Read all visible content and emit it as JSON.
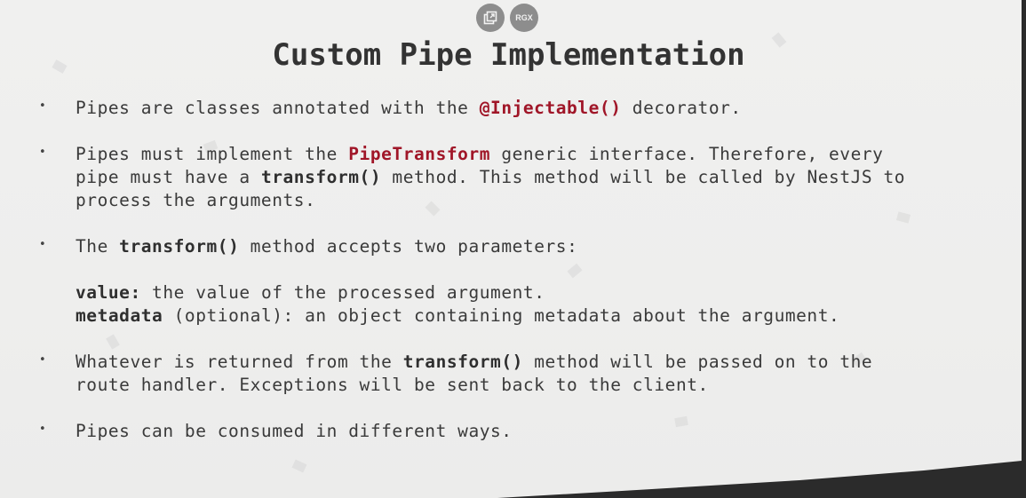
{
  "toolbar": {
    "icons": [
      {
        "name": "popout-icon",
        "glyph": "⧉"
      },
      {
        "name": "rgx-icon",
        "label": "RGX"
      }
    ]
  },
  "slide": {
    "title": "Custom Pipe Implementation",
    "b1": {
      "t1": "Pipes are classes annotated with the ",
      "code": "@Injectable()",
      "t2": " decorator."
    },
    "b2": {
      "t1": "Pipes must implement the ",
      "code": "PipeTransform",
      "t2": " generic interface. Therefore, every",
      "t3": "pipe must have a ",
      "code2": "transform()",
      "t4": " method. This method will be called by NestJS to",
      "t5": "process the arguments."
    },
    "b3": {
      "t1": "The ",
      "code": "transform()",
      "t2": " method accepts two parameters:"
    },
    "params": {
      "p1_name": "value:",
      "p1_desc": " the value of the processed argument.",
      "p2_name": "metadata",
      "p2_desc": " (optional): an object containing metadata about the argument."
    },
    "b4": {
      "t1": "Whatever is returned from the ",
      "code": "transform()",
      "t2": " method will be passed on to the",
      "t3": "route handler. Exceptions will be sent back to the client."
    },
    "b5": {
      "t1": "Pipes can be consumed in different ways."
    },
    "bullet_glyph": "•"
  },
  "colors": {
    "accent_red": "#a01628",
    "text": "#3a3a3a",
    "background": "#efefee"
  }
}
